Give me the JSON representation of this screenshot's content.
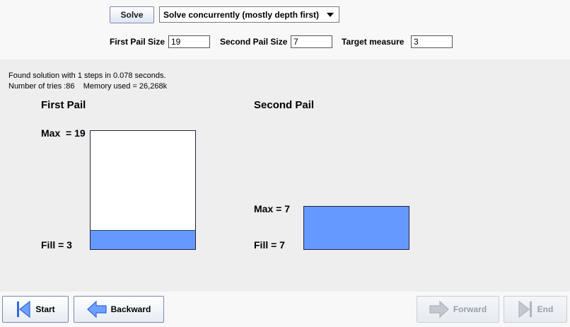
{
  "toolbar": {
    "solve_label": "Solve",
    "strategy_selected": "Solve concurrently (mostly depth first)"
  },
  "params": {
    "first_pail_label": "First Pail Size",
    "first_pail_value": "19",
    "second_pail_label": "Second Pail Size",
    "second_pail_value": "7",
    "target_label": "Target measure",
    "target_value": "3"
  },
  "status": {
    "line1": "Found solution with 1 steps in 0.078 seconds.",
    "line2": "Number of tries :86    Memory used = 26,268k"
  },
  "pails": {
    "first": {
      "title": "First Pail",
      "max_label": "Max  = 19",
      "fill_label": "Fill = 3",
      "max": 19,
      "fill": 3
    },
    "second": {
      "title": "Second Pail",
      "max_label": "Max = 7",
      "fill_label": "Fill = 7",
      "max": 7,
      "fill": 7
    }
  },
  "nav": {
    "start_label": "Start",
    "backward_label": "Backward",
    "forward_label": "Forward",
    "end_label": "End"
  },
  "colors": {
    "water": "#6699ff",
    "nav_icon": "#3366dd",
    "nav_icon_disabled": "#b0b4bc"
  },
  "icons": {
    "start": "skip-start-icon",
    "backward": "arrow-left-icon",
    "forward": "arrow-right-icon",
    "end": "skip-end-icon",
    "dropdown": "triangle-down-icon"
  }
}
